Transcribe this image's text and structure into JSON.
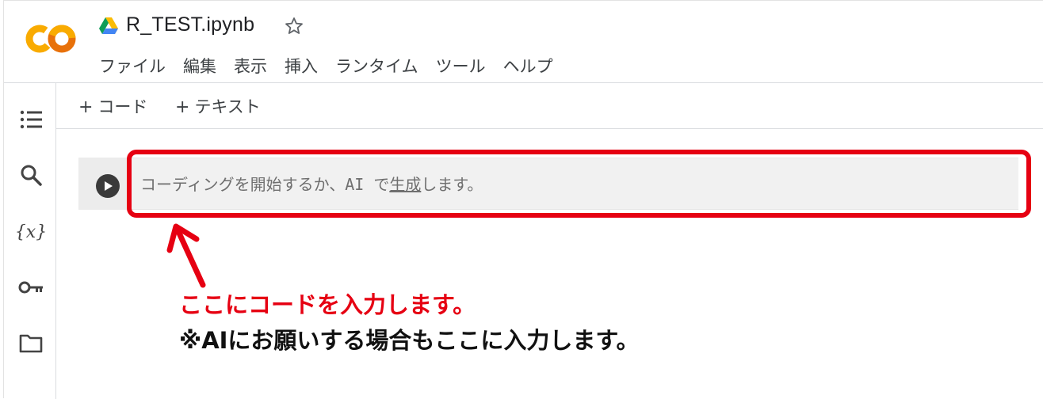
{
  "app": {
    "logo_text": "CO",
    "file_title": "R_TEST.ipynb",
    "star_icon": "star-outline-icon",
    "drive_icon": "google-drive-icon"
  },
  "menu": {
    "items": [
      "ファイル",
      "編集",
      "表示",
      "挿入",
      "ランタイム",
      "ツール",
      "ヘルプ"
    ]
  },
  "toolbar": {
    "add_code_label": "コード",
    "add_text_label": "テキスト",
    "plus": "+"
  },
  "sidebar": {
    "icons": [
      "table-of-contents-icon",
      "search-icon",
      "variables-icon",
      "secrets-key-icon",
      "folder-icon"
    ],
    "variables_glyph": "{x}"
  },
  "cell": {
    "placeholder_before": "コーディングを開始するか、AI で",
    "generate_link": "生成",
    "placeholder_after": "します。"
  },
  "annotation": {
    "line1": "ここにコードを入力します。",
    "line2": "※AIにお願いする場合もここに入力します。"
  },
  "colors": {
    "highlight": "#e60012",
    "logo_orange": "#f9ab00",
    "logo_dark_orange": "#e8710a"
  }
}
